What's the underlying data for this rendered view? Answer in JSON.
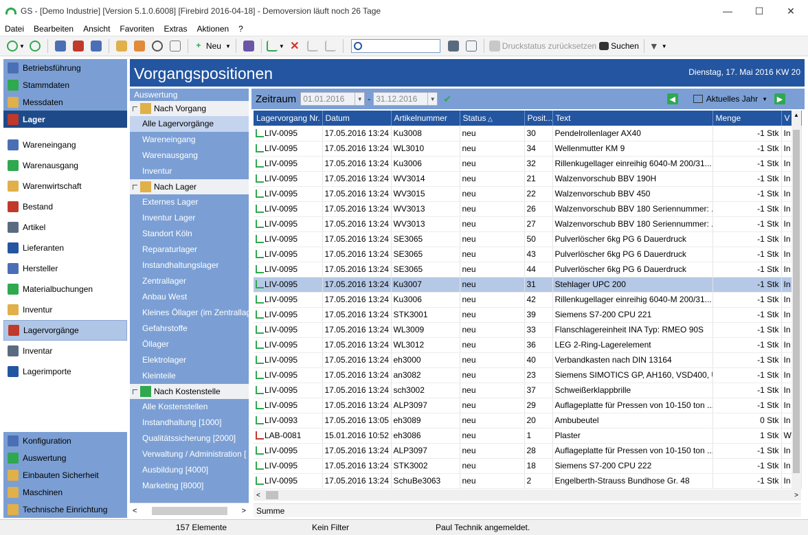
{
  "window": {
    "title": "GS - [Demo Industrie]  [Version  5.1.0.6008]  [Firebird 2016-04-18]  - Demoversion läuft noch 26 Tage"
  },
  "menu": [
    "Datei",
    "Bearbeiten",
    "Ansicht",
    "Favoriten",
    "Extras",
    "Aktionen",
    "?"
  ],
  "toolbar": {
    "new_label": "Neu",
    "search_placeholder": "",
    "reset_print_label": "Druckstatus zurücksetzen",
    "search_label": "Suchen"
  },
  "leftnav": {
    "top": [
      {
        "label": "Betriebsführung",
        "icon": "dashboard-icon"
      },
      {
        "label": "Stammdaten",
        "icon": "stamp-icon"
      },
      {
        "label": "Messdaten",
        "icon": "pen-icon"
      },
      {
        "label": "Lager",
        "icon": "warehouse-icon",
        "active": true
      }
    ],
    "middle": [
      {
        "label": "Wareneingang",
        "icon": "goods-in-icon"
      },
      {
        "label": "Warenausgang",
        "icon": "goods-out-icon"
      },
      {
        "label": "Warenwirtschaft",
        "icon": "inventory-icon"
      },
      {
        "label": "Bestand",
        "icon": "stock-icon"
      },
      {
        "label": "Artikel",
        "icon": "article-icon"
      },
      {
        "label": "Lieferanten",
        "icon": "supplier-icon"
      },
      {
        "label": "Hersteller",
        "icon": "manufacturer-icon"
      },
      {
        "label": "Materialbuchungen",
        "icon": "material-icon"
      },
      {
        "label": "Inventur",
        "icon": "stocktake-icon"
      },
      {
        "label": "Lagervorgänge",
        "icon": "stock-movement-icon",
        "selected": true
      },
      {
        "label": "Inventar",
        "icon": "inventar-icon"
      },
      {
        "label": "Lagerimporte",
        "icon": "import-icon"
      }
    ],
    "bottom": [
      {
        "label": "Konfiguration",
        "icon": "gear-icon"
      },
      {
        "label": "Auswertung",
        "icon": "chart-icon"
      },
      {
        "label": "Einbauten Sicherheit",
        "icon": "folder-icon"
      },
      {
        "label": "Maschinen",
        "icon": "folder-icon"
      },
      {
        "label": "Technische Einrichtung",
        "icon": "folder-icon"
      }
    ]
  },
  "header": {
    "title": "Vorgangspositionen",
    "date": "Dienstag, 17. Mai 2016  KW 20"
  },
  "midpanel": {
    "heading": "Auswertung",
    "groups": [
      {
        "label": "Nach Vorgang",
        "items": [
          "Alle Lagervorgänge",
          "Wareneingang",
          "Warenausgang",
          "Inventur"
        ],
        "selected": 0
      },
      {
        "label": "Nach Lager",
        "items": [
          "Externes Lager",
          "Inventur Lager",
          "Standort Köln",
          "Reparaturlager",
          "Instandhaltungslager",
          "Zentrallager",
          "Anbau West",
          "Kleines Öllager (im Zentrallag",
          "Gefahrstoffe",
          "Öllager",
          "Elektrolager",
          "Kleinteile"
        ]
      },
      {
        "label": "Nach Kostenstelle",
        "items": [
          "Alle Kostenstellen",
          "Instandhaltung [1000]",
          "Qualitätssicherung [2000]",
          "Verwaltung / Administration [",
          "Ausbildung [4000]",
          "Marketing [8000]"
        ]
      }
    ]
  },
  "filter": {
    "label": "Zeitraum",
    "from": "01.01.2016",
    "to": "31.12.2016",
    "period": "Aktuelles Jahr"
  },
  "table": {
    "columns": [
      "Lagervorgang Nr.",
      "Datum",
      "Artikelnummer",
      "Status",
      "Posit...",
      "Text",
      "Menge",
      "V"
    ],
    "rows": [
      [
        "LIV-0095",
        "17.05.2016 13:24",
        "Ku3008",
        "neu",
        "30",
        "Pendelrollenlager AX40",
        "-1 Stk",
        "In"
      ],
      [
        "LIV-0095",
        "17.05.2016 13:24",
        "WL3010",
        "neu",
        "34",
        "Wellenmutter KM 9",
        "-1 Stk",
        "In"
      ],
      [
        "LIV-0095",
        "17.05.2016 13:24",
        "Ku3006",
        "neu",
        "32",
        "Rillenkugellager einreihig 6040-M 200/31...",
        "-1 Stk",
        "In"
      ],
      [
        "LIV-0095",
        "17.05.2016 13:24",
        "WV3014",
        "neu",
        "21",
        "Walzenvorschub BBV 190H",
        "-1 Stk",
        "In"
      ],
      [
        "LIV-0095",
        "17.05.2016 13:24",
        "WV3015",
        "neu",
        "22",
        "Walzenvorschub BBV 450",
        "-1 Stk",
        "In"
      ],
      [
        "LIV-0095",
        "17.05.2016 13:24",
        "WV3013",
        "neu",
        "26",
        "Walzenvorschub BBV 180 Seriennummer: ...",
        "-1 Stk",
        "In"
      ],
      [
        "LIV-0095",
        "17.05.2016 13:24",
        "WV3013",
        "neu",
        "27",
        "Walzenvorschub BBV 180 Seriennummer: ...",
        "-1 Stk",
        "In"
      ],
      [
        "LIV-0095",
        "17.05.2016 13:24",
        "SE3065",
        "neu",
        "50",
        "Pulverlöscher 6kg  PG 6 Dauerdruck",
        "-1 Stk",
        "In"
      ],
      [
        "LIV-0095",
        "17.05.2016 13:24",
        "SE3065",
        "neu",
        "43",
        "Pulverlöscher 6kg  PG 6 Dauerdruck",
        "-1 Stk",
        "In"
      ],
      [
        "LIV-0095",
        "17.05.2016 13:24",
        "SE3065",
        "neu",
        "44",
        "Pulverlöscher 6kg  PG 6 Dauerdruck",
        "-1 Stk",
        "In"
      ],
      [
        "LIV-0095",
        "17.05.2016 13:24",
        "Ku3007",
        "neu",
        "31",
        "Stehlager UPC 200",
        "-1 Stk",
        "In"
      ],
      [
        "LIV-0095",
        "17.05.2016 13:24",
        "Ku3006",
        "neu",
        "42",
        "Rillenkugellager einreihig 6040-M 200/31...",
        "-1 Stk",
        "In"
      ],
      [
        "LIV-0095",
        "17.05.2016 13:24",
        "STK3001",
        "neu",
        "39",
        "Siemens S7-200 CPU 221",
        "-1 Stk",
        "In"
      ],
      [
        "LIV-0095",
        "17.05.2016 13:24",
        "WL3009",
        "neu",
        "33",
        "Flanschlagereinheit INA Typ: RMEO 90S",
        "-1 Stk",
        "In"
      ],
      [
        "LIV-0095",
        "17.05.2016 13:24",
        "WL3012",
        "neu",
        "36",
        "LEG 2-Ring-Lagerelement",
        "-1 Stk",
        "In"
      ],
      [
        "LIV-0095",
        "17.05.2016 13:24",
        "eh3000",
        "neu",
        "40",
        "Verbandkasten nach DIN 13164",
        "-1 Stk",
        "In"
      ],
      [
        "LIV-0095",
        "17.05.2016 13:24",
        "an3082",
        "neu",
        "23",
        "Siemens SIMOTICS GP, AH160, VSD400, U...",
        "-1 Stk",
        "In"
      ],
      [
        "LIV-0095",
        "17.05.2016 13:24",
        "sch3002",
        "neu",
        "37",
        "Schweißerklappbrille",
        "-1 Stk",
        "In"
      ],
      [
        "LIV-0095",
        "17.05.2016 13:24",
        "ALP3097",
        "neu",
        "29",
        "Auflageplatte für Pressen von 10-150 ton ...",
        "-1 Stk",
        "In"
      ],
      [
        "LIV-0093",
        "17.05.2016 13:05",
        "eh3089",
        "neu",
        "20",
        "Ambubeutel",
        "0 Stk",
        "In"
      ],
      [
        "LAB-0081",
        "15.01.2016 10:52",
        "eh3086",
        "neu",
        "1",
        "Plaster",
        "1 Stk",
        "W"
      ],
      [
        "LIV-0095",
        "17.05.2016 13:24",
        "ALP3097",
        "neu",
        "28",
        "Auflageplatte für Pressen von 10-150 ton ...",
        "-1 Stk",
        "In"
      ],
      [
        "LIV-0095",
        "17.05.2016 13:24",
        "STK3002",
        "neu",
        "18",
        "Siemens S7-200 CPU 222",
        "-1 Stk",
        "In"
      ],
      [
        "LIV-0095",
        "17.05.2016 13:24",
        "SchuBe3063",
        "neu",
        "2",
        "Engelberth-Strauss Bundhose Gr. 48",
        "-1 Stk",
        "In"
      ]
    ],
    "selected_row": 10,
    "sum_label": "Summe"
  },
  "statusbar": {
    "count": "157 Elemente",
    "filter": "Kein Filter",
    "user": "Paul Technik angemeldet."
  }
}
